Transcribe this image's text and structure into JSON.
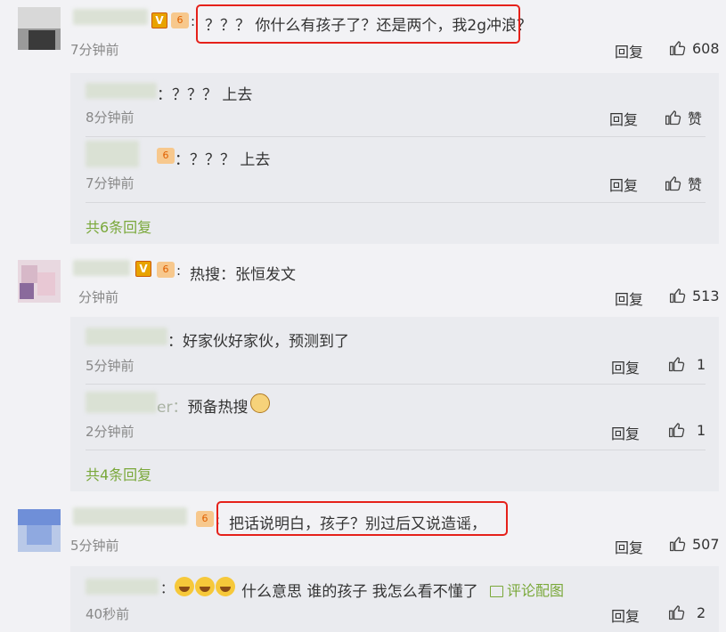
{
  "colors": {
    "accent_green": "#7aa83a",
    "highlight_red": "#e5211a",
    "reply_bg": "#eaebef"
  },
  "comments": [
    {
      "text": "？？？ 你什么有孩子了？还是两个，我2g冲浪？",
      "time": "7分钟前",
      "reply_label": "回复",
      "likes": "608",
      "replies": [
        {
          "name_suffix": "：",
          "text": "？？？ 上去",
          "time": "8分钟前",
          "reply_label": "回复",
          "likes": "赞"
        },
        {
          "name_suffix": "：",
          "text": "？？？ 上去",
          "time": "7分钟前",
          "reply_label": "回复",
          "likes": "赞"
        }
      ],
      "more_replies": "共6条回复"
    },
    {
      "text": "热搜：张恒发文",
      "time": "分钟前",
      "reply_label": "回复",
      "likes": "513",
      "replies": [
        {
          "name_suffix": "：",
          "text": "好家伙好家伙，预测到了",
          "time": "5分钟前",
          "reply_label": "回复",
          "likes": "1"
        },
        {
          "name_suffix": "er：",
          "text": "预备热搜",
          "time": "2分钟前",
          "reply_label": "回复",
          "likes": "1"
        }
      ],
      "more_replies": "共4条回复"
    },
    {
      "text": "把话说明白，孩子？别过后又说造谣，",
      "time": "5分钟前",
      "reply_label": "回复",
      "likes": "507",
      "replies": [
        {
          "name_suffix": "：",
          "text": "什么意思 谁的孩子 我怎么看不懂了",
          "pic_link": "评论配图",
          "time": "40秒前",
          "reply_label": "回复",
          "likes": "2"
        }
      ]
    }
  ],
  "icons": {
    "thumb": "thumb-up-icon",
    "verified": "verified-v-icon",
    "level": "level-badge-icon",
    "laugh": "laugh-cry-emoji",
    "dog": "doge-emoji",
    "picture": "picture-icon"
  }
}
